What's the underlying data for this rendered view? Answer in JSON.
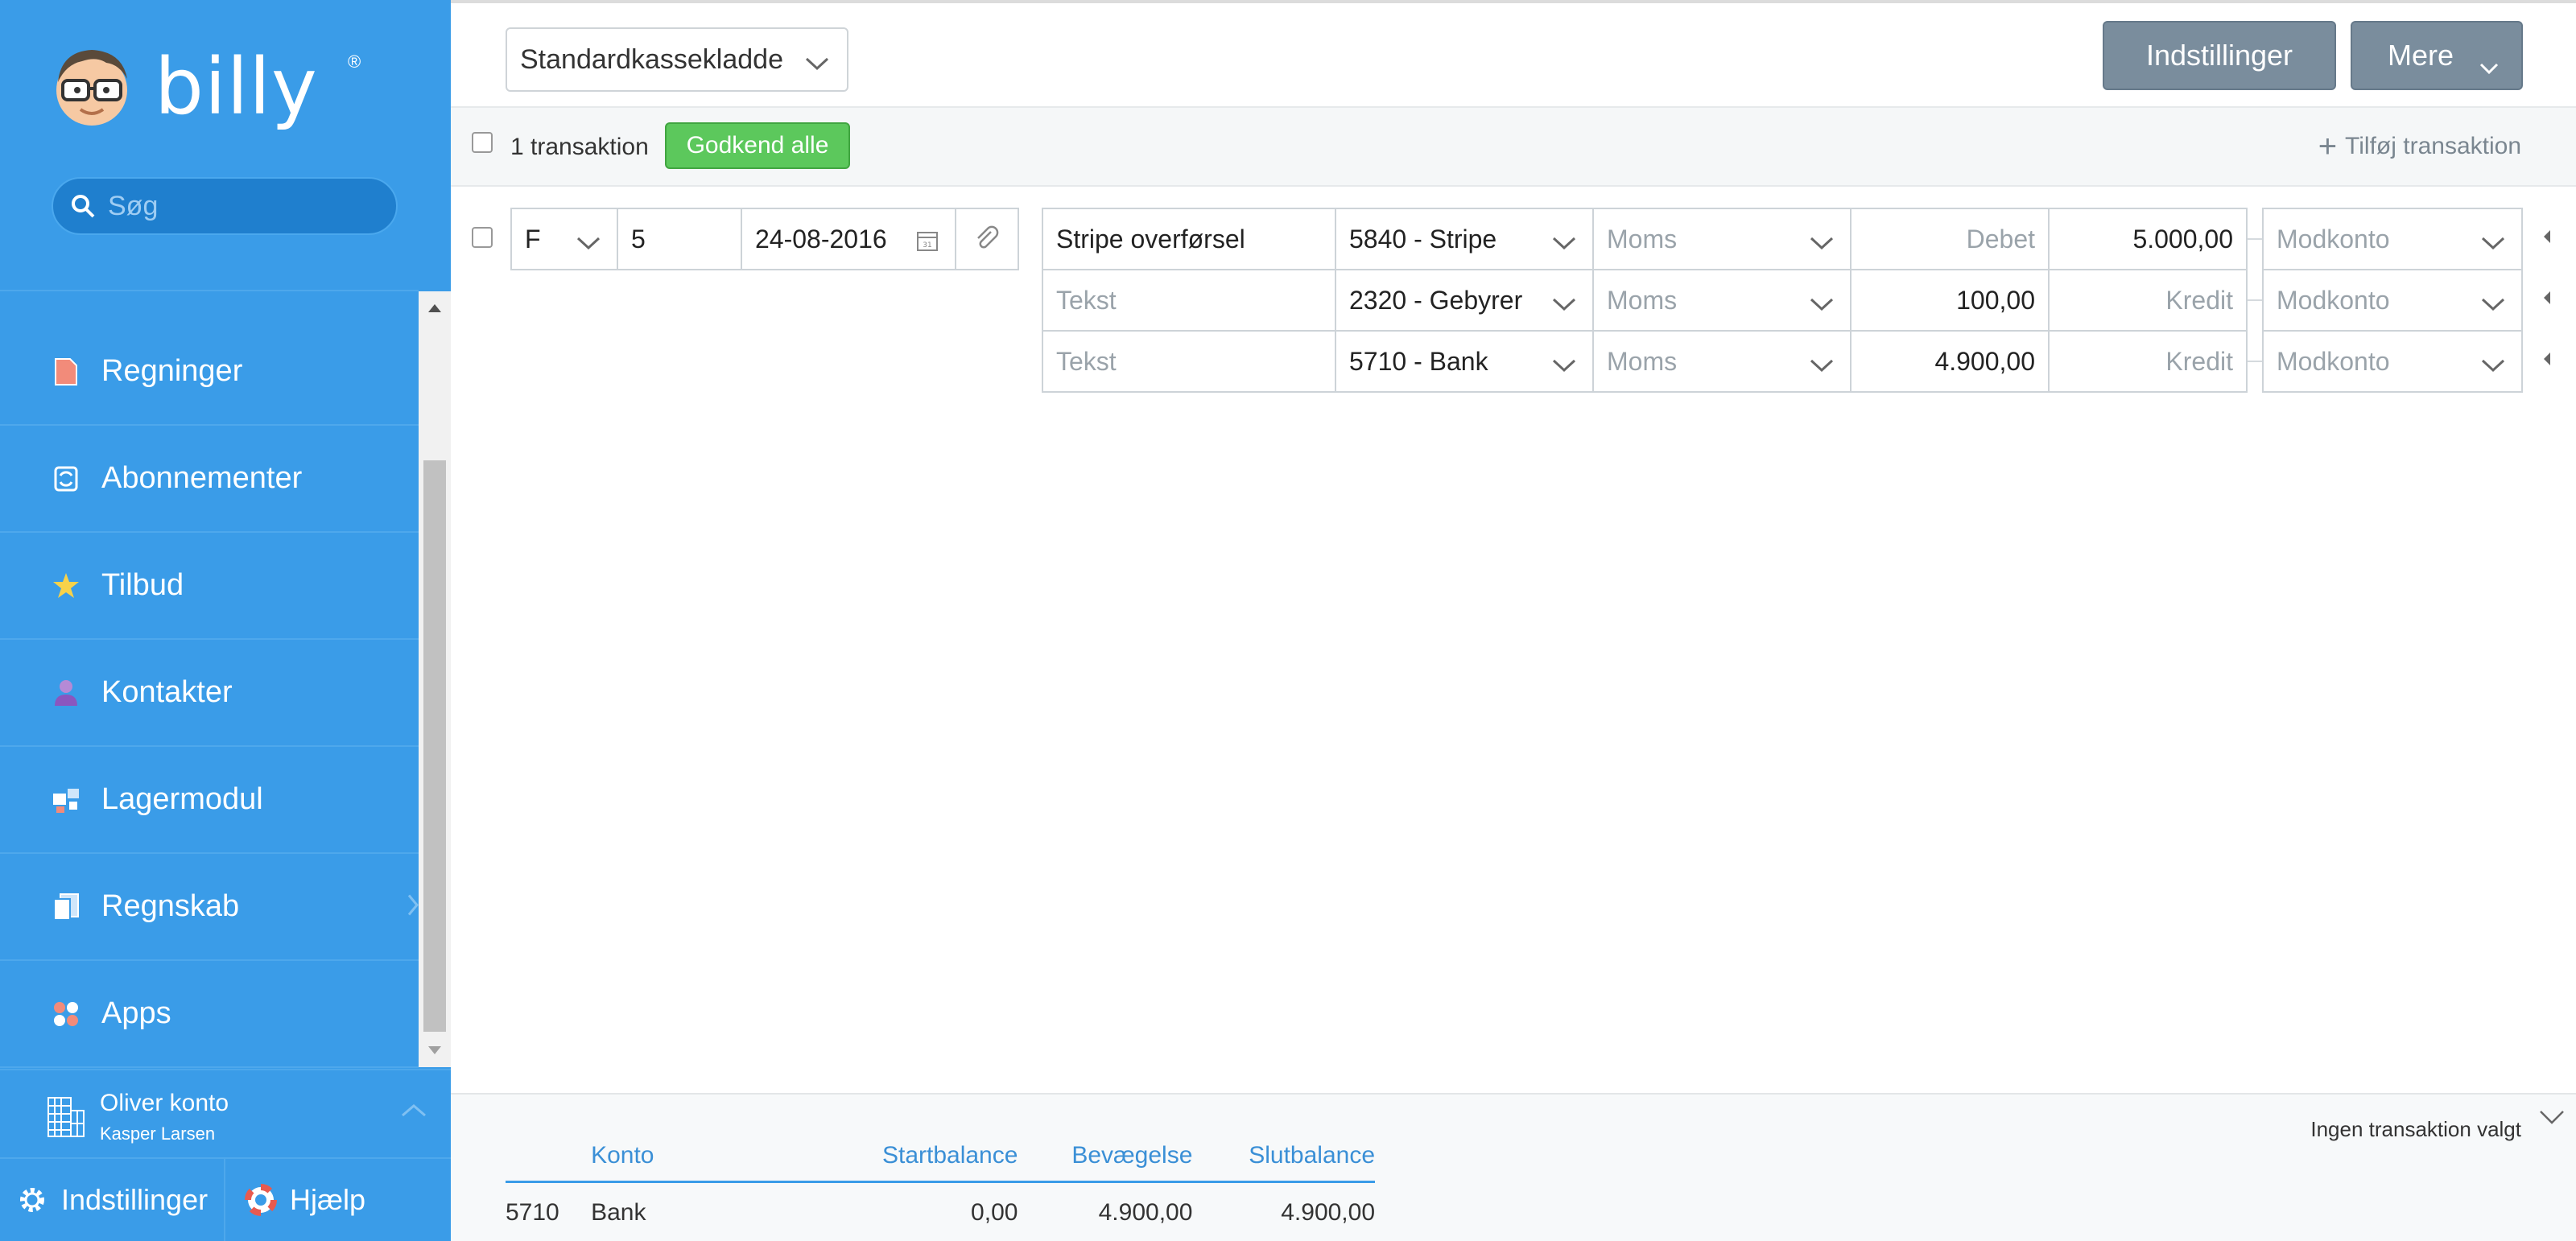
{
  "sidebar": {
    "brand": "billy",
    "brand_mark": "®",
    "search_placeholder": "Søg",
    "items": [
      {
        "label": "Regninger",
        "icon": "bill-icon"
      },
      {
        "label": "Abonnementer",
        "icon": "subscription-icon"
      },
      {
        "label": "Tilbud",
        "icon": "star-icon"
      },
      {
        "label": "Kontakter",
        "icon": "person-icon"
      },
      {
        "label": "Lagermodul",
        "icon": "inventory-icon"
      },
      {
        "label": "Regnskab",
        "icon": "accounting-icon"
      },
      {
        "label": "Apps",
        "icon": "apps-icon"
      }
    ],
    "org": {
      "name": "Oliver konto",
      "user": "Kasper Larsen"
    },
    "bottom": {
      "settings_label": "Indstillinger",
      "help_label": "Hjælp"
    }
  },
  "topbar": {
    "ledger": "Standardkassekladde",
    "settings_label": "Indstillinger",
    "more_label": "Mere"
  },
  "toolbar": {
    "count_label": "1 transaktion",
    "approve_label": "Godkend alle",
    "add_label": "Tilføj transaktion"
  },
  "transaction": {
    "type": "F",
    "number": "5",
    "date": "24-08-2016",
    "lines": [
      {
        "text": "Stripe overførsel",
        "text_is_placeholder": false,
        "account": "5840 - Stripe",
        "vat": "Moms",
        "debit": "Debet",
        "debit_is_placeholder": true,
        "credit": "5.000,00",
        "credit_is_placeholder": false,
        "offset": "Modkonto"
      },
      {
        "text": "Tekst",
        "text_is_placeholder": true,
        "account": "2320 - Gebyrer",
        "vat": "Moms",
        "debit": "100,00",
        "debit_is_placeholder": false,
        "credit": "Kredit",
        "credit_is_placeholder": true,
        "offset": "Modkonto"
      },
      {
        "text": "Tekst",
        "text_is_placeholder": true,
        "account": "5710 - Bank",
        "vat": "Moms",
        "debit": "4.900,00",
        "debit_is_placeholder": false,
        "credit": "Kredit",
        "credit_is_placeholder": true,
        "offset": "Modkonto"
      }
    ]
  },
  "balance": {
    "no_selection": "Ingen transaktion valgt",
    "headers": {
      "account": "Konto",
      "start": "Startbalance",
      "movement": "Bevægelse",
      "end": "Slutbalance"
    },
    "rows": [
      {
        "number": "5710",
        "account": "Bank",
        "start": "0,00",
        "movement": "4.900,00",
        "end": "4.900,00"
      }
    ]
  },
  "colors": {
    "sidebar": "#3a9ce8",
    "approve": "#5cc85c",
    "button_gray": "#7a8d9d",
    "link_blue": "#3a8fd6"
  }
}
